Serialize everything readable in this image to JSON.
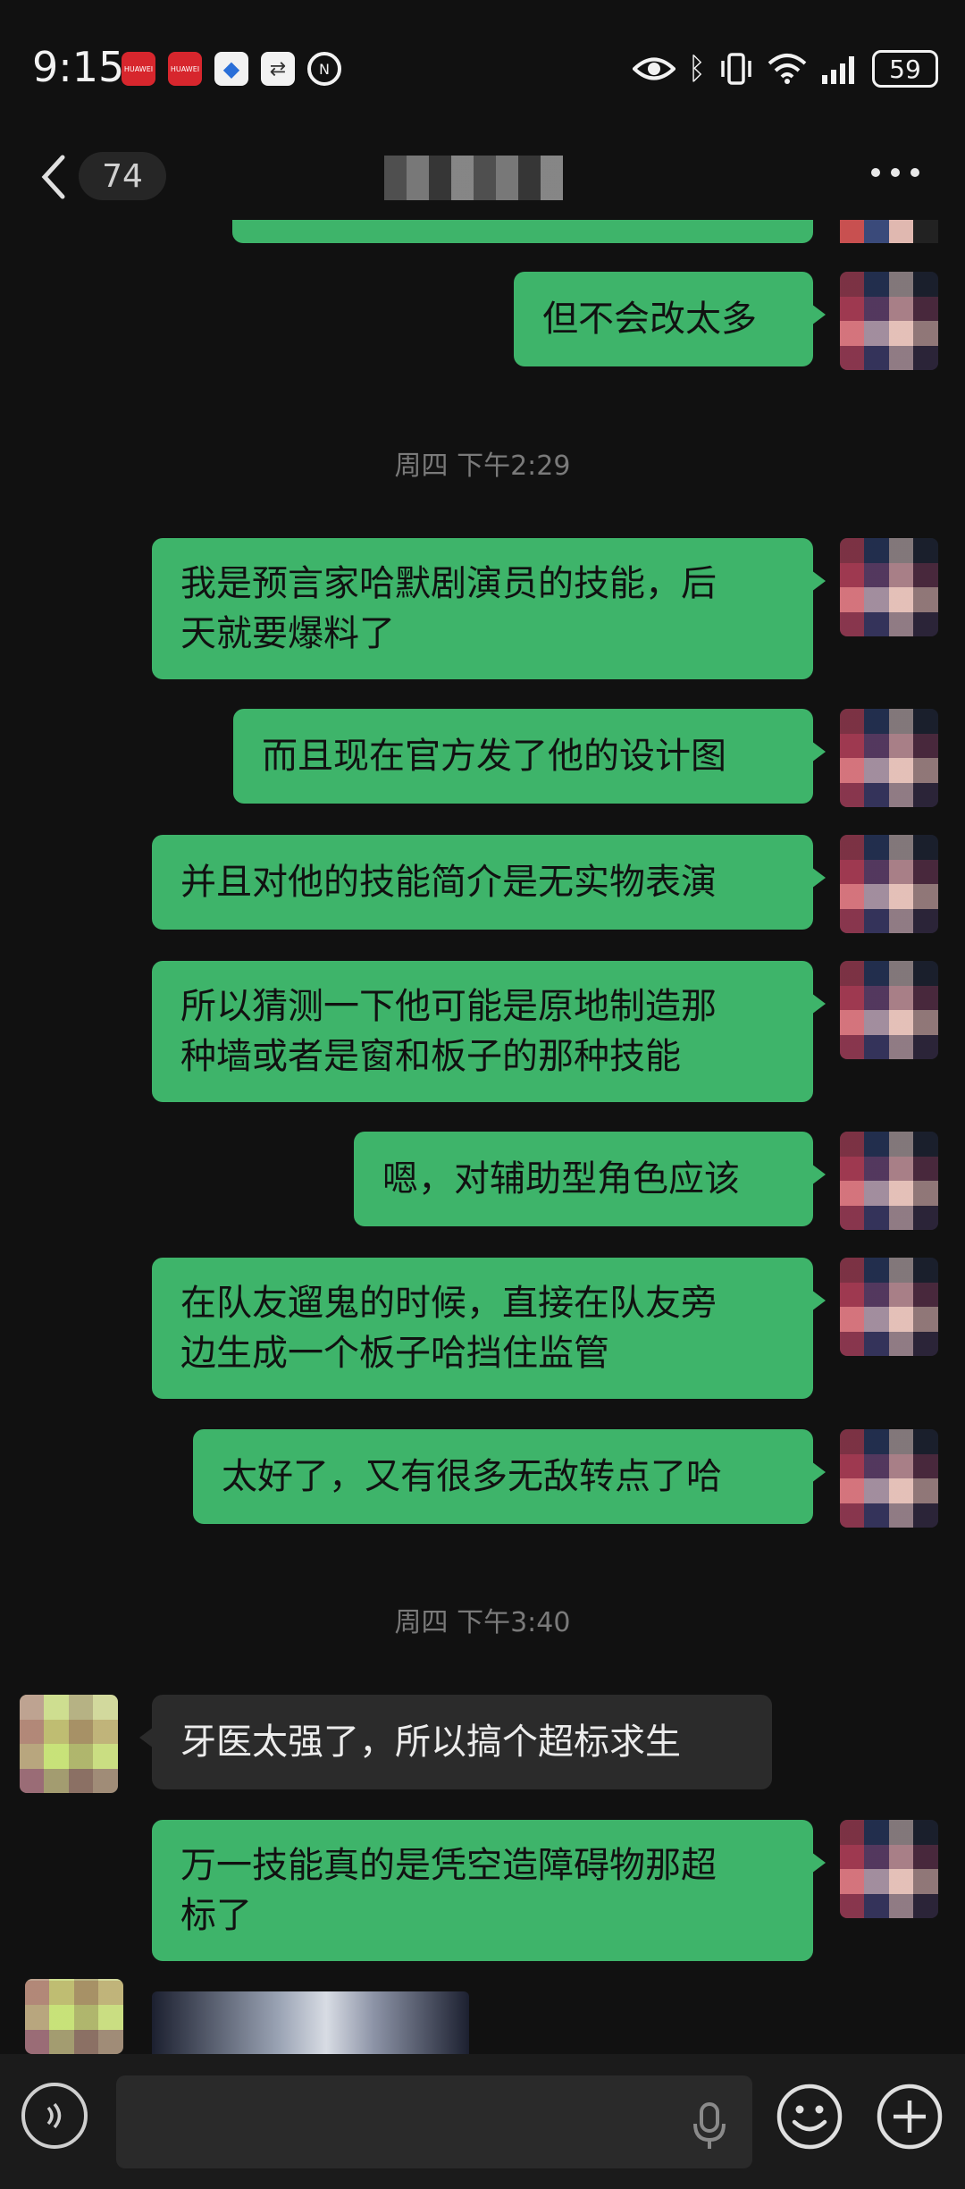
{
  "status_bar": {
    "time": "9:15",
    "battery": "59",
    "left_icons": [
      "huawei-app-icon",
      "huawei-app-icon",
      "shield-app-icon",
      "sync-app-icon",
      "nfc-icon"
    ],
    "right_icons": [
      "eye-icon",
      "bluetooth-icon",
      "vibrate-icon",
      "wifi-icon",
      "signal-icon",
      "battery-icon"
    ],
    "huawei_label": "HUAWEI"
  },
  "nav": {
    "unread_count": "74"
  },
  "messages": [
    {
      "id": "m1",
      "side": "out",
      "text": "但不会改太多"
    },
    {
      "id": "ts1",
      "type": "timestamp",
      "text": "周四 下午2:29"
    },
    {
      "id": "m2",
      "side": "out",
      "line1": "我是预言家哈默剧演员的技能，后",
      "line2": "天就要爆料了"
    },
    {
      "id": "m3",
      "side": "out",
      "text": "而且现在官方发了他的设计图"
    },
    {
      "id": "m4",
      "side": "out",
      "text": "并且对他的技能简介是无实物表演"
    },
    {
      "id": "m5",
      "side": "out",
      "line1": "所以猜测一下他可能是原地制造那",
      "line2": "种墙或者是窗和板子的那种技能"
    },
    {
      "id": "m6",
      "side": "out",
      "text": "嗯，对辅助型角色应该"
    },
    {
      "id": "m7",
      "side": "out",
      "line1": "在队友遛鬼的时候，直接在队友旁",
      "line2": "边生成一个板子哈挡住监管"
    },
    {
      "id": "m8",
      "side": "out",
      "text": "太好了，又有很多无敌转点了哈"
    },
    {
      "id": "ts2",
      "type": "timestamp",
      "text": "周四 下午3:40"
    },
    {
      "id": "m9",
      "side": "in",
      "text": "牙医太强了，所以搞个超标求生"
    },
    {
      "id": "m10",
      "side": "out",
      "line1": "万一技能真的是凭空造障碍物那超",
      "line2": "标了"
    }
  ],
  "input": {
    "value": "",
    "placeholder": ""
  },
  "colors": {
    "background": "#111111",
    "bubble_out": "#3eb46a",
    "bubble_in": "#2b2b2b",
    "timestamp": "#7a7a7a"
  }
}
